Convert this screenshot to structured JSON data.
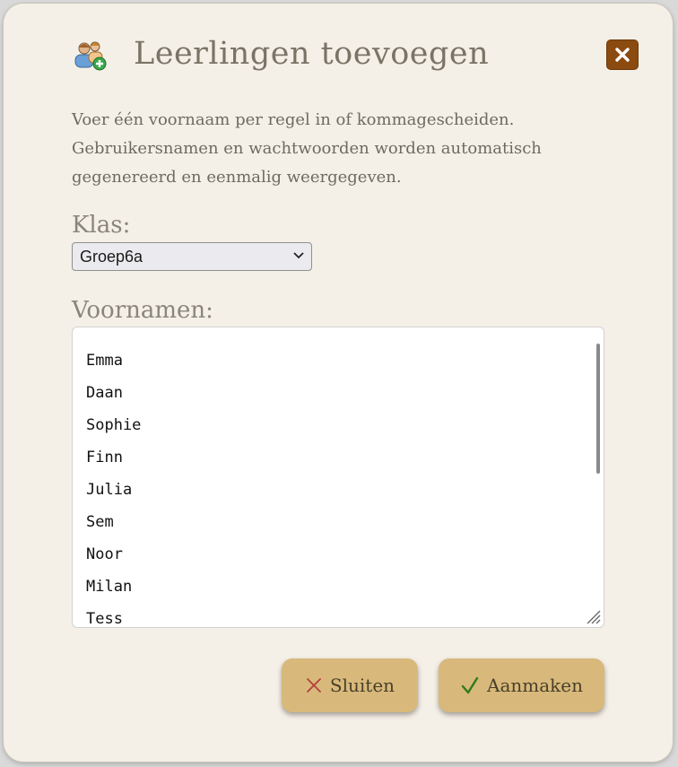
{
  "dialog": {
    "title": "Leerlingen toevoegen",
    "intro": "Voer één voornaam per regel in of kommagescheiden. Gebruikersnamen en wachtwoorden worden automatisch gegenereerd en eenmalig weergegeven.",
    "class_label": "Klas:",
    "class_selected": "Groep6a",
    "names_label": "Voornamen:",
    "names": [
      "Emma",
      "Daan",
      "Sophie",
      "Finn",
      "Julia",
      "Sem",
      "Noor",
      "Milan",
      "Tess"
    ],
    "close_button": "Sluiten",
    "create_button": "Aanmaken"
  },
  "icons": {
    "title": "add-users-icon",
    "close": "close-icon",
    "dropdown": "chevron-down-icon",
    "cancel": "cross-icon",
    "confirm": "checkmark-icon"
  },
  "colors": {
    "dialog_bg": "#f5f0e7",
    "close_bg": "#8a4a10",
    "button_bg": "#d8b97b",
    "cross_color": "#b5403a",
    "check_color": "#2f7a1f"
  }
}
